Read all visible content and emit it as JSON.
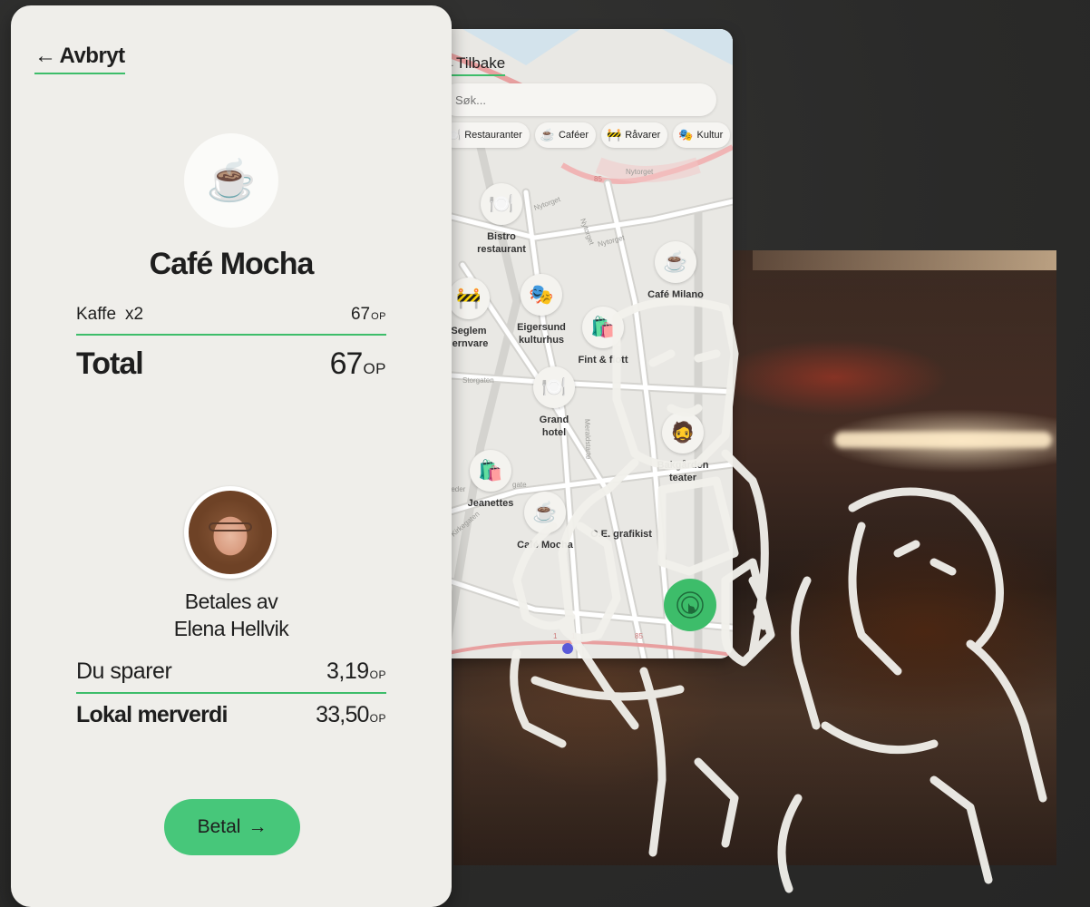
{
  "payment": {
    "back_label": "Avbryt",
    "cafe_icon": "coffee-cup",
    "cafe_name": "Café Mocha",
    "item": {
      "name": "Kaffe",
      "qty": "x2",
      "price": "67",
      "unit": "OP"
    },
    "total": {
      "label": "Total",
      "amount": "67",
      "unit": "OP"
    },
    "payer_line1": "Betales av",
    "payer_line2": "Elena Hellvik",
    "savings": {
      "label": "Du sparer",
      "amount": "3,19",
      "unit": "OP"
    },
    "local_value": {
      "label": "Lokal merverdi",
      "amount": "33,50",
      "unit": "OP"
    },
    "pay_button": "Betal",
    "pay_arrow": "→",
    "accent": "#3dbd6a"
  },
  "map": {
    "back_label": "Tilbake",
    "search_placeholder": "Søk...",
    "chips": [
      {
        "icon": "🍽️",
        "label": "Restauranter"
      },
      {
        "icon": "☕",
        "label": "Caféer"
      },
      {
        "icon": "🚧",
        "label": "Råvarer"
      },
      {
        "icon": "🎭",
        "label": "Kultur"
      }
    ],
    "street_labels": [
      "Nytorget",
      "Nytorget",
      "Nytorget",
      "Nytorget",
      "Storgaten",
      "Peder",
      "gate",
      "Kirkegaten",
      "Meraldstarte"
    ],
    "road_numbers": [
      "85",
      "85",
      "1",
      "1"
    ],
    "pois": [
      {
        "icon": "🍽️",
        "label": "Bistro restaurant"
      },
      {
        "icon": "☕",
        "label": "Café Milano"
      },
      {
        "icon": "🚧",
        "label": "Seglem jernvare"
      },
      {
        "icon": "🎭",
        "label": "Eigersund kulturhus"
      },
      {
        "icon": "🛍️",
        "label": "Fint & flott"
      },
      {
        "icon": "🍽️",
        "label": "Grand hotel"
      },
      {
        "icon": "🧔",
        "label": "Bakgården teater"
      },
      {
        "icon": "🛍️",
        "label": "Jeanettes"
      },
      {
        "icon": "☕",
        "label": "Café Mocha"
      },
      {
        "icon": "",
        "label": "O.E. grafikist"
      }
    ],
    "locate_icon": "tap-hand-icon"
  }
}
